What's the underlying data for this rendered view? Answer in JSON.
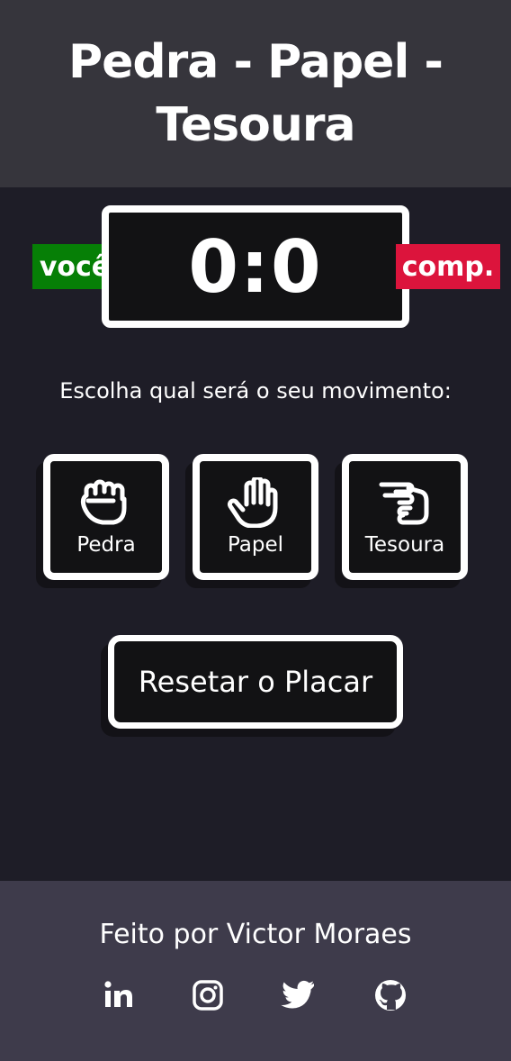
{
  "header": {
    "title": "Pedra - Papel - Tesoura"
  },
  "scoreboard": {
    "score": "0:0",
    "user_label": "você",
    "computer_label": "comp."
  },
  "prompt": "Escolha qual será o seu movimento:",
  "moves": [
    {
      "label": "Pedra",
      "icon": "fist-icon"
    },
    {
      "label": "Papel",
      "icon": "open-hand-icon"
    },
    {
      "label": "Tesoura",
      "icon": "scissors-hand-icon"
    }
  ],
  "reset_label": "Resetar o Placar",
  "footer": {
    "credit": "Feito por Victor Moraes",
    "socials": [
      "linkedin-icon",
      "instagram-icon",
      "twitter-icon",
      "github-icon"
    ]
  },
  "colors": {
    "header_bg": "#36353c",
    "body_bg": "#1e1d27",
    "footer_bg": "#3e3b4b",
    "user_badge": "#067f06",
    "computer_badge": "#dc143c",
    "panel": "#121214"
  }
}
